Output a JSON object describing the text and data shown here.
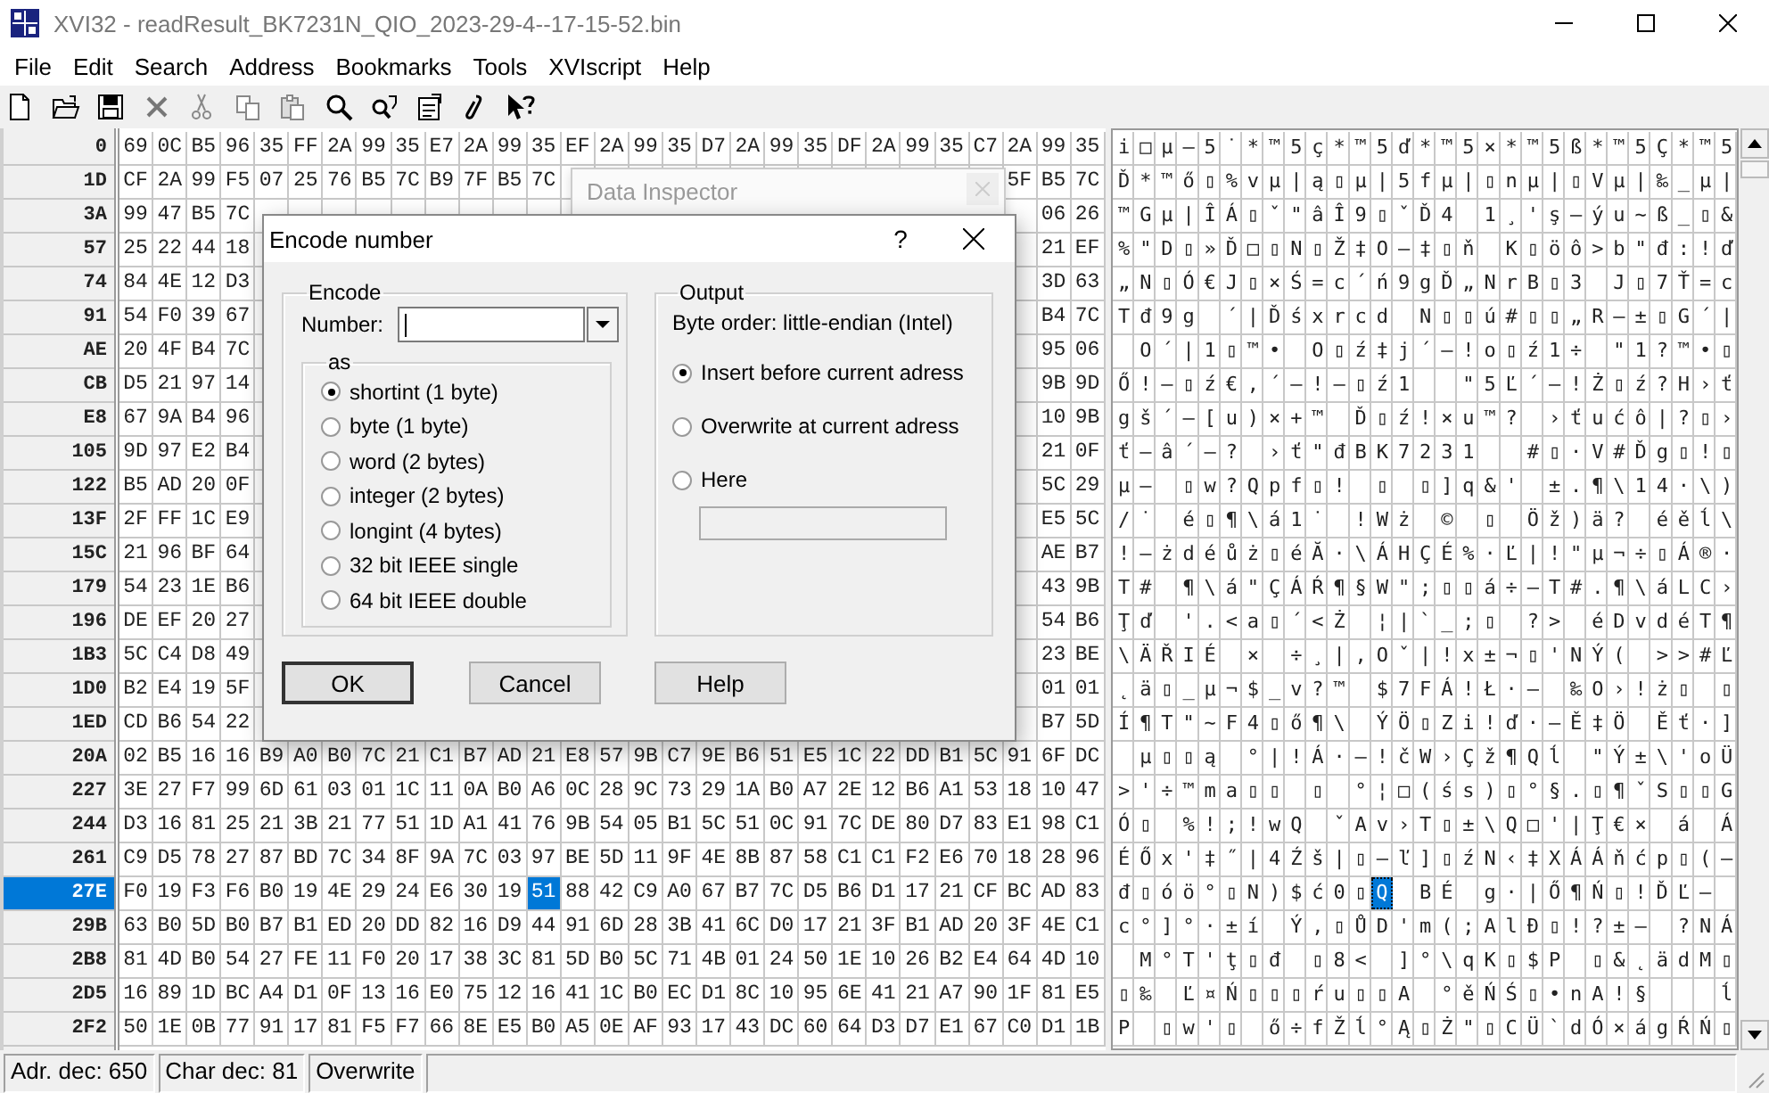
{
  "window": {
    "title": "XVI32 - readResult_BK7231N_QIO_2023-29-4--17-15-52.bin"
  },
  "menu": [
    "File",
    "Edit",
    "Search",
    "Address",
    "Bookmarks",
    "Tools",
    "XVIscript",
    "Help"
  ],
  "hex_rows": [
    {
      "address": "0",
      "selected": false,
      "bytes": [
        "69",
        "0C",
        "B5",
        "96",
        "35",
        "FF",
        "2A",
        "99",
        "35",
        "E7",
        "2A",
        "99",
        "35",
        "EF",
        "2A",
        "99",
        "35",
        "D7",
        "2A",
        "99",
        "35",
        "DF",
        "2A",
        "99",
        "35",
        "C7",
        "2A",
        "99",
        "35"
      ],
      "chars": "i□µ–5˙*™5ç*™5ď*™5×*™5ß*™5Ç*™5"
    },
    {
      "address": "1D",
      "selected": false,
      "bytes": [
        "CF",
        "2A",
        "99",
        "F5",
        "07",
        "25",
        "76",
        "B5",
        "7C",
        "B9",
        "7F",
        "B5",
        "7C"
      ],
      "bytes_end": [
        "5F",
        "B5",
        "7C"
      ],
      "chars": "Ď*™ő▯%vµ|ą▯µ|5fµ|▯nµ|▯Vµ|‰_µ|"
    },
    {
      "address": "3A",
      "selected": false,
      "bytes": [
        "99",
        "47",
        "B5",
        "7C"
      ],
      "bytes_end": [
        "06",
        "26"
      ],
      "chars": "™Gµ|ÎÁ▯ˇ\"âÎ9▯ˇĎ4 1¸'ş–ýu~ß_▯&"
    },
    {
      "address": "57",
      "selected": false,
      "bytes": [
        "25",
        "22",
        "44",
        "18"
      ],
      "bytes_end": [
        "21",
        "EF"
      ],
      "chars": "%\"D▯»Ď□▯N▯Ž‡O–‡▯ň K▯öô>b\"đ:!ď"
    },
    {
      "address": "74",
      "selected": false,
      "bytes": [
        "84",
        "4E",
        "12",
        "D3"
      ],
      "bytes_end": [
        "3D",
        "63"
      ],
      "chars": "„N▯Ó€J▯×Ś=c´ń9gĎ„NrB▯3 J▯7Ť=c"
    },
    {
      "address": "91",
      "selected": false,
      "bytes": [
        "54",
        "F0",
        "39",
        "67"
      ],
      "bytes_end": [
        "B4",
        "7C"
      ],
      "chars": "Tđ9g ´|Ďśxrcd N▯▯ú#▯▯„R–±▯G´|"
    },
    {
      "address": "AE",
      "selected": false,
      "bytes": [
        "20",
        "4F",
        "B4",
        "7C"
      ],
      "bytes_end": [
        "95",
        "06"
      ],
      "chars": " O´|1▯™• O▯ź‡j´–!o▯ź1÷ \"1?™•▯"
    },
    {
      "address": "CB",
      "selected": false,
      "bytes": [
        "D5",
        "21",
        "97",
        "14"
      ],
      "bytes_end": [
        "9B",
        "9D"
      ],
      "chars": "Ő!—▯ź€‚´—!—▯ź1  \"5Ľ´—!Ż▯ź?H›ť"
    },
    {
      "address": "E8",
      "selected": false,
      "bytes": [
        "67",
        "9A",
        "B4",
        "96"
      ],
      "bytes_end": [
        "10",
        "9B"
      ],
      "chars": "gš´–[u)×+™ Ď▯ź!×u™? ›ťućô|?▯›"
    },
    {
      "address": "105",
      "selected": false,
      "bytes": [
        "9D",
        "97",
        "E2",
        "B4"
      ],
      "bytes_end": [
        "21",
        "0F"
      ],
      "chars": "ť—â´–? ›ť\"đBK7231  #▯·V#Ďg▯!▯"
    },
    {
      "address": "122",
      "selected": false,
      "bytes": [
        "B5",
        "AD",
        "20",
        "0F"
      ],
      "bytes_end": [
        "5C",
        "29"
      ],
      "chars": "µ– ▯w?Qpf▯! ▯ ▯]q&' ±.¶\\14·\\)"
    },
    {
      "address": "13F",
      "selected": false,
      "bytes": [
        "2F",
        "FF",
        "1C",
        "E9"
      ],
      "bytes_end": [
        "E5",
        "5C"
      ],
      "chars": "/˙ é▯¶\\á1˙ !Wż © ▯ Öž)ä? éěĺ\\"
    },
    {
      "address": "15C",
      "selected": false,
      "bytes": [
        "21",
        "96",
        "BF",
        "64"
      ],
      "bytes_end": [
        "AE",
        "B7"
      ],
      "chars": "!–żdéůż▯éĂ·\\ÁHÇÉ%·Ľ|!\"µ¬÷▯Á®·"
    },
    {
      "address": "179",
      "selected": false,
      "bytes": [
        "54",
        "23",
        "1E",
        "B6"
      ],
      "bytes_end": [
        "43",
        "9B"
      ],
      "chars": "T# ¶\\á\"ÇÁŔ¶§W\";▯▯á÷–T#.¶\\áLC›"
    },
    {
      "address": "196",
      "selected": false,
      "bytes": [
        "DE",
        "EF",
        "20",
        "27"
      ],
      "bytes_end": [
        "54",
        "B6"
      ],
      "chars": "Ţď '.<a▯´<Ż ¦|`_;▯ ?> éDvdéT¶"
    },
    {
      "address": "1B3",
      "selected": false,
      "bytes": [
        "5C",
        "C4",
        "D8",
        "49"
      ],
      "bytes_end": [
        "23",
        "BE"
      ],
      "chars": "\\ÄŘIÉ × ÷¸|‚Oˇ|!x±¬▯'NÝ( >>#Ľ"
    },
    {
      "address": "1D0",
      "selected": false,
      "bytes": [
        "B2",
        "E4",
        "19",
        "5F"
      ],
      "bytes_end": [
        "01",
        "01"
      ],
      "chars": "˛ä▯_µ¬$_v?™ $7FÁ!Ł·– ‰O›!ż▯ ▯"
    },
    {
      "address": "1ED",
      "selected": false,
      "bytes": [
        "CD",
        "B6",
        "54",
        "22"
      ],
      "bytes_end": [
        "B7",
        "5D"
      ],
      "chars": "Í¶T\"~F4▯ő¶\\ ÝÖ▯Zi!ď·–Ě‡Ö Ěť·]"
    },
    {
      "address": "20A",
      "selected": false,
      "bytes": [
        "02",
        "B5",
        "16",
        "16",
        "B9",
        "A0",
        "B0",
        "7C",
        "21",
        "C1",
        "B7",
        "AD",
        "21",
        "E8",
        "57",
        "9B",
        "C7",
        "9E",
        "B6",
        "51",
        "E5",
        "1C",
        "22",
        "DD",
        "B1",
        "5C",
        "91",
        "6F",
        "DC"
      ],
      "chars": " µ▯▯ą °|!Á·–!čW›Çž¶Qĺ \"Ý±\\'oÜ"
    },
    {
      "address": "227",
      "selected": false,
      "bytes": [
        "3E",
        "27",
        "F7",
        "99",
        "6D",
        "61",
        "03",
        "01",
        "1C",
        "11",
        "0A",
        "B0",
        "A6",
        "0C",
        "28",
        "9C",
        "73",
        "29",
        "1A",
        "B0",
        "A7",
        "2E",
        "12",
        "B6",
        "A1",
        "53",
        "18",
        "10",
        "47"
      ],
      "chars": ">'÷™ma▯▯ ▯ °¦□(śs)▯°§.▯¶ˇS▯▯G"
    },
    {
      "address": "244",
      "selected": false,
      "bytes": [
        "D3",
        "16",
        "81",
        "25",
        "21",
        "3B",
        "21",
        "77",
        "51",
        "1D",
        "A1",
        "41",
        "76",
        "9B",
        "54",
        "05",
        "B1",
        "5C",
        "51",
        "0C",
        "91",
        "7C",
        "DE",
        "80",
        "D7",
        "83",
        "E1",
        "98",
        "C1"
      ],
      "chars": "Ó▯ %!;!wQ ˇAv›T▯±\\Q□'|Ţ€× á Á"
    },
    {
      "address": "261",
      "selected": false,
      "bytes": [
        "C9",
        "D5",
        "78",
        "27",
        "87",
        "BD",
        "7C",
        "34",
        "8F",
        "9A",
        "7C",
        "03",
        "97",
        "BE",
        "5D",
        "11",
        "9F",
        "4E",
        "8B",
        "87",
        "58",
        "C1",
        "C1",
        "F2",
        "E6",
        "70",
        "18",
        "28",
        "96"
      ],
      "chars": "ÉŐx'‡˝|4Źš|▯—ľ]▯źN‹‡XÁÁňćp▯(–"
    },
    {
      "address": "27E",
      "selected": true,
      "bytes": [
        "F0",
        "19",
        "F3",
        "F6",
        "B0",
        "19",
        "4E",
        "29",
        "24",
        "E6",
        "30",
        "19"
      ],
      "cursor": {
        "hex": "51",
        "char": "Q"
      },
      "bytes_after": [
        "88",
        "42",
        "C9",
        "A0",
        "67",
        "B7",
        "7C",
        "D5",
        "B6",
        "D1",
        "17",
        "21",
        "CF",
        "BC",
        "AD",
        "83"
      ],
      "chars": "đ▯óö°▯N)$ć0▯",
      "chars_after": " BÉ g·|Ő¶Ń▯!ĎĽ– "
    },
    {
      "address": "29B",
      "selected": false,
      "bytes": [
        "63",
        "B0",
        "5D",
        "B0",
        "B7",
        "B1",
        "ED",
        "20",
        "DD",
        "82",
        "16",
        "D9",
        "44",
        "91",
        "6D",
        "28",
        "3B",
        "41",
        "6C",
        "D0",
        "17",
        "21",
        "3F",
        "B1",
        "AD",
        "20",
        "3F",
        "4E",
        "C1"
      ],
      "chars": "c°]°·±í Ý‚▯ŮD'm(;AlĐ▯!?±– ?NÁ"
    },
    {
      "address": "2B8",
      "selected": false,
      "bytes": [
        "81",
        "4D",
        "B0",
        "54",
        "27",
        "FE",
        "11",
        "F0",
        "20",
        "17",
        "38",
        "3C",
        "81",
        "5D",
        "B0",
        "5C",
        "71",
        "4B",
        "01",
        "24",
        "50",
        "1E",
        "10",
        "26",
        "B2",
        "E4",
        "64",
        "4D",
        "10"
      ],
      "chars": " M°T'ţ▯đ ▯8< ]°\\qK▯$P ▯&˛ädM▯"
    },
    {
      "address": "2D5",
      "selected": false,
      "bytes": [
        "16",
        "89",
        "1D",
        "BC",
        "A4",
        "D1",
        "0F",
        "13",
        "16",
        "E0",
        "75",
        "12",
        "16",
        "41",
        "1C",
        "B0",
        "EC",
        "D1",
        "8C",
        "10",
        "95",
        "6E",
        "41",
        "21",
        "A7",
        "90",
        "1F",
        "81",
        "E5"
      ],
      "chars": "▯‰ Ľ¤Ń▯▯▯ŕu▯▯A °ěŃŚ▯•nA!§   ĺ"
    },
    {
      "address": "2F2",
      "selected": false,
      "bytes": [
        "50",
        "1E",
        "0B",
        "77",
        "91",
        "17",
        "81",
        "F5",
        "F7",
        "66",
        "8E",
        "E5",
        "B0",
        "A5",
        "0E",
        "AF",
        "93",
        "17",
        "43",
        "DC",
        "60",
        "64",
        "D3",
        "D7",
        "E1",
        "67",
        "C0",
        "D1",
        "1B"
      ],
      "chars": "P ▯w'▯ ő÷fŽĺ°Ą▯Ż\"▯CÜ`dÓ×ágŔŃ▯"
    }
  ],
  "data_inspector": {
    "title": "Data Inspector"
  },
  "dialog": {
    "title": "Encode number",
    "help": "?",
    "encode": {
      "legend": "Encode",
      "number_label": "Number:",
      "as_legend": "as",
      "options": [
        {
          "label": "shortint (1 byte)",
          "selected": true
        },
        {
          "label": "byte (1 byte)",
          "selected": false
        },
        {
          "label": "word (2 bytes)",
          "selected": false
        },
        {
          "label": "integer (2 bytes)",
          "selected": false
        },
        {
          "label": "longint (4 bytes)",
          "selected": false
        },
        {
          "label": "32 bit IEEE single",
          "selected": false
        },
        {
          "label": "64 bit IEEE double",
          "selected": false
        }
      ]
    },
    "output": {
      "legend": "Output",
      "byte_order": "Byte order: little-endian (Intel)",
      "options": [
        {
          "label": "Insert before current adress",
          "selected": true
        },
        {
          "label": "Overwrite at current adress",
          "selected": false
        },
        {
          "label": "Here",
          "selected": false
        }
      ]
    },
    "buttons": [
      "OK",
      "Cancel",
      "Help"
    ]
  },
  "status_bar": [
    "Adr. dec: 650",
    "Char dec: 81",
    "Overwrite"
  ]
}
